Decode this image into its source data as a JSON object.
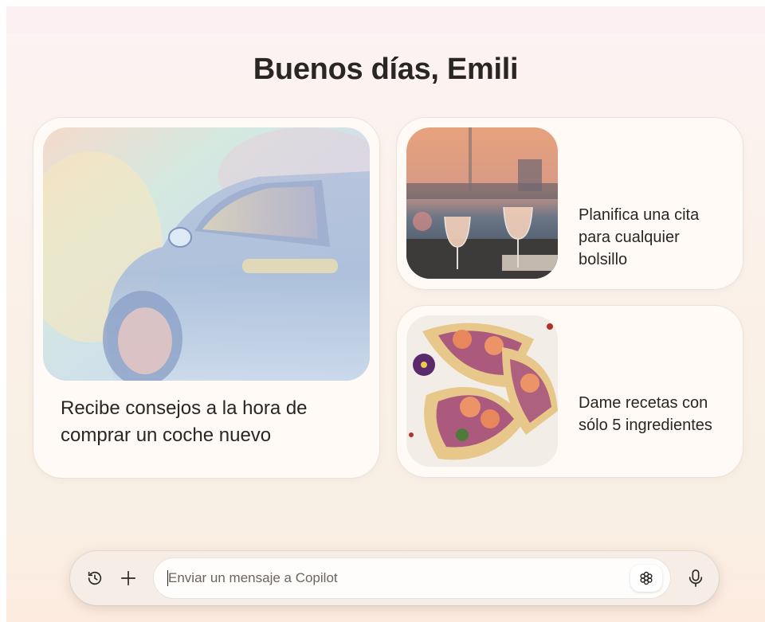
{
  "greeting": "Buenos días, Emili",
  "cards": [
    {
      "title": "Recibe consejos a la hora de comprar un coche nuevo",
      "image": "car-image"
    },
    {
      "title": "Planifica una cita para cualquier bolsillo",
      "image": "wine-glasses-image"
    },
    {
      "title": "Dame recetas con sólo 5 ingredientes",
      "image": "tacos-image"
    }
  ],
  "chatbar": {
    "placeholder": "Enviar un mensaje a Copilot",
    "history_icon": "history-icon",
    "plus_icon": "plus-icon",
    "smart_icon": "smart-mode-icon",
    "mic_icon": "microphone-icon"
  },
  "colors": {
    "background": "#fbf1e9",
    "card": "#fffaf5",
    "text": "#2a2623"
  }
}
